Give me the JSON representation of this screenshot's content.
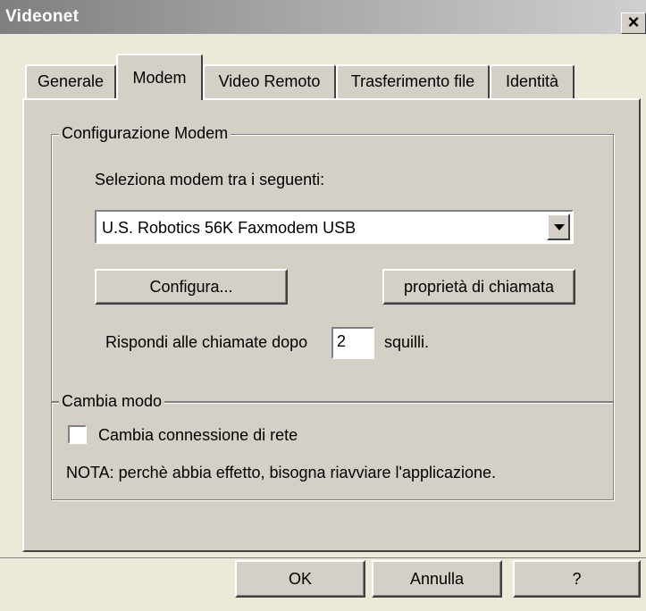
{
  "window": {
    "title": "Videonet",
    "close_label": "×"
  },
  "tabs": [
    {
      "label": "Generale",
      "active": false
    },
    {
      "label": "Modem",
      "active": true
    },
    {
      "label": "Video Remoto",
      "active": false
    },
    {
      "label": "Trasferimento file",
      "active": false
    },
    {
      "label": "Identità",
      "active": false
    }
  ],
  "modem_group": {
    "title": "Configurazione Modem",
    "select_label": "Seleziona modem tra i seguenti:",
    "selected_modem": "U.S. Robotics 56K Faxmodem USB",
    "configure_button": "Configura...",
    "call_properties_button": "proprietà di chiamata",
    "answer_prefix": "Rispondi alle chiamate dopo",
    "answer_rings": "2",
    "answer_suffix": "squilli."
  },
  "mode_group": {
    "title": "Cambia modo",
    "checkbox_label": "Cambia connessione di rete",
    "checkbox_checked": false,
    "note": "NOTA: perchè abbia effetto, bisogna riavviare l'applicazione."
  },
  "footer": {
    "ok_label": "OK",
    "cancel_label": "Annulla",
    "help_label": "?"
  }
}
